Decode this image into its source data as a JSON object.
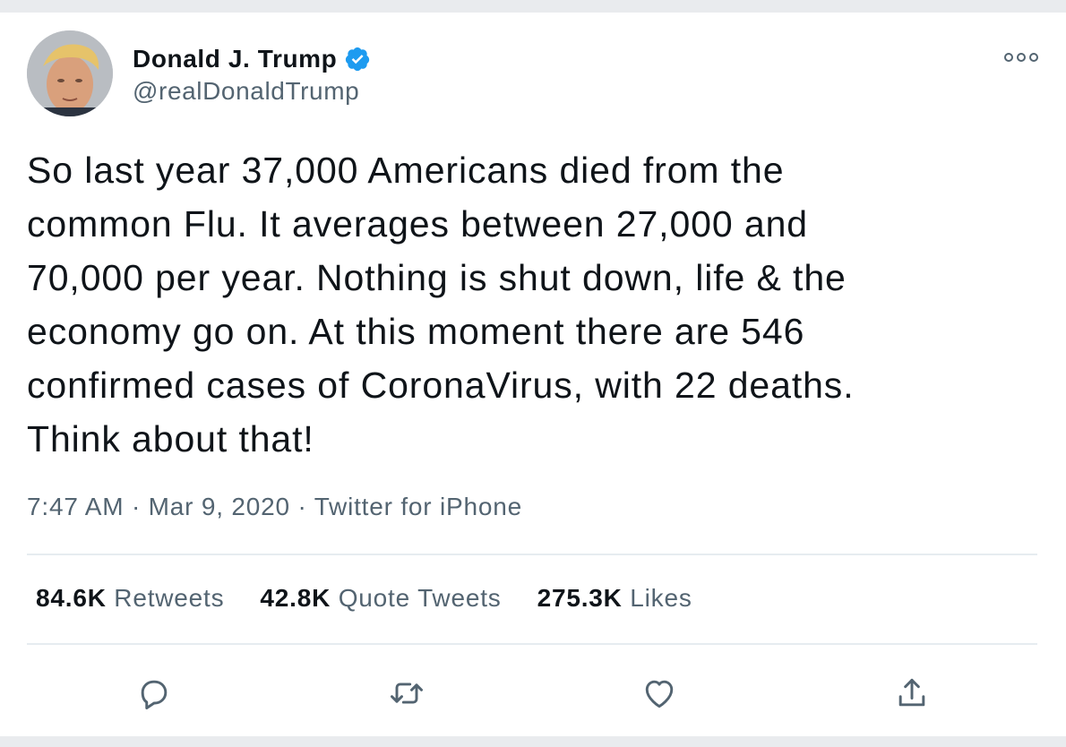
{
  "author": {
    "name": "Donald J. Trump",
    "handle": "@realDonaldTrump",
    "verified": true
  },
  "tweet": {
    "text": "So last year 37,000 Americans died from the\ncommon Flu. It averages between 27,000 and\n70,000 per year. Nothing is shut down, life & the\neconomy go on. At this moment there are 546\nconfirmed cases of CoronaVirus, with 22 deaths.\nThink about that!",
    "time": "7:47 AM",
    "date": "Mar 9, 2020",
    "source": "Twitter for iPhone",
    "separator": "·"
  },
  "stats": {
    "retweets_count": "84.6K",
    "retweets_label": "Retweets",
    "quotes_count": "42.8K",
    "quotes_label": "Quote Tweets",
    "likes_count": "275.3K",
    "likes_label": "Likes"
  },
  "icons": {
    "more": "more-options-icon",
    "reply": "reply-icon",
    "retweet": "retweet-icon",
    "like": "heart-icon",
    "share": "share-icon",
    "verified": "verified-badge-icon"
  },
  "colors": {
    "verified_blue": "#1d9bf0",
    "text_primary": "#0f1419",
    "text_secondary": "#536471",
    "icon_gray": "#536471"
  }
}
